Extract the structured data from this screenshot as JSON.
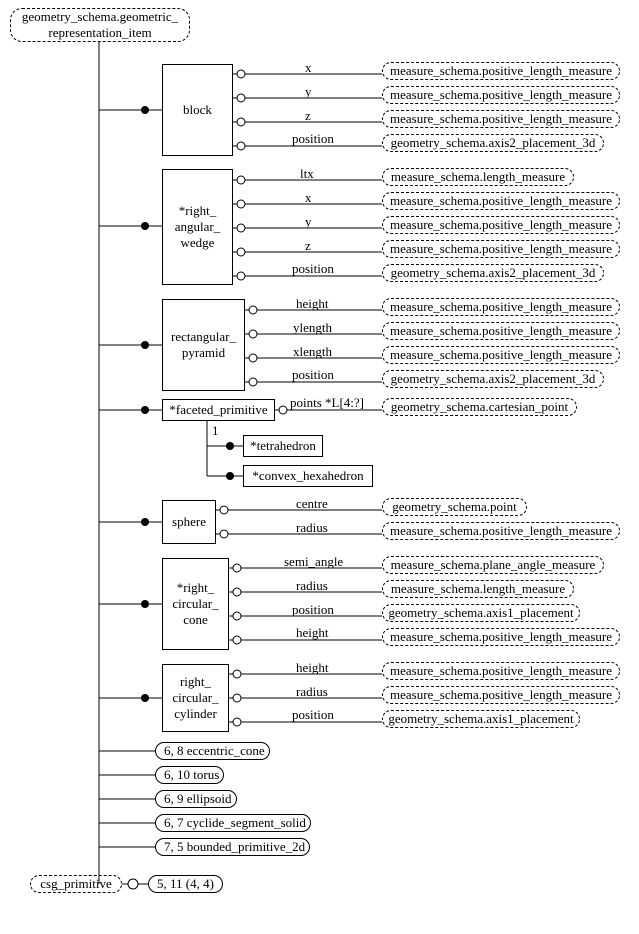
{
  "root": "geometry_schema.geometric_\nrepresentation_item",
  "block": {
    "name": "block",
    "attrs": [
      "x",
      "y",
      "z",
      "position"
    ],
    "types": [
      "measure_schema.positive_length_measure",
      "measure_schema.positive_length_measure",
      "measure_schema.positive_length_measure",
      "geometry_schema.axis2_placement_3d"
    ]
  },
  "wedge": {
    "name": "*right_\nangular_\nwedge",
    "attrs": [
      "ltx",
      "x",
      "y",
      "z",
      "position"
    ],
    "types": [
      "measure_schema.length_measure",
      "measure_schema.positive_length_measure",
      "measure_schema.positive_length_measure",
      "measure_schema.positive_length_measure",
      "geometry_schema.axis2_placement_3d"
    ]
  },
  "pyramid": {
    "name": "rectangular_\npyramid",
    "attrs": [
      "height",
      "ylength",
      "xlength",
      "position"
    ],
    "types": [
      "measure_schema.positive_length_measure",
      "measure_schema.positive_length_measure",
      "measure_schema.positive_length_measure",
      "geometry_schema.axis2_placement_3d"
    ]
  },
  "faceted": {
    "name": "*faceted_primitive",
    "attr": "points *L[4:?]",
    "type": "geometry_schema.cartesian_point"
  },
  "one": "1",
  "tetra": "*tetrahedron",
  "hexa": "*convex_hexahedron",
  "sphere": {
    "name": "sphere",
    "attrs": [
      "centre",
      "radius"
    ],
    "types": [
      "geometry_schema.point",
      "measure_schema.positive_length_measure"
    ]
  },
  "cone": {
    "name": "*right_\ncircular_\ncone",
    "attrs": [
      "semi_angle",
      "radius",
      "position",
      "height"
    ],
    "types": [
      "measure_schema.plane_angle_measure",
      "measure_schema.length_measure",
      "geometry_schema.axis1_placement",
      "measure_schema.positive_length_measure"
    ]
  },
  "cylinder": {
    "name": "right_\ncircular_\ncylinder",
    "attrs": [
      "height",
      "radius",
      "position"
    ],
    "types": [
      "measure_schema.positive_length_measure",
      "measure_schema.positive_length_measure",
      "geometry_schema.axis1_placement"
    ]
  },
  "refs": [
    "6, 8 eccentric_cone",
    "6, 10 torus",
    "6, 9 ellipsoid",
    "6, 7 cyclide_segment_solid",
    "7, 5 bounded_primitive_2d"
  ],
  "csg": "csg_primitive",
  "csg_ref": "5, 11 (4, 4)"
}
